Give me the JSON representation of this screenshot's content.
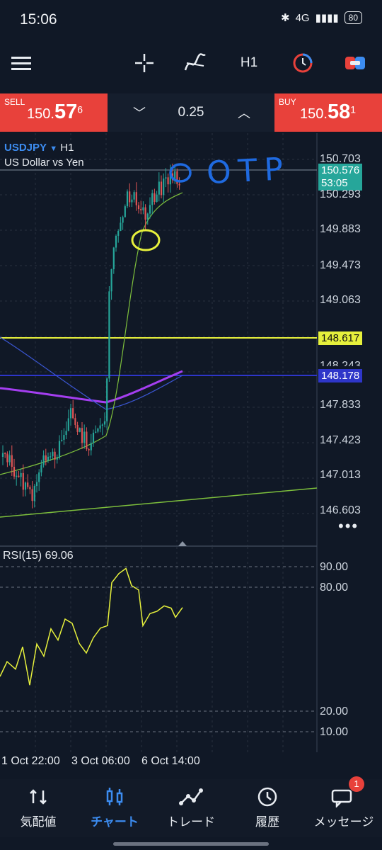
{
  "status": {
    "time": "15:06",
    "network": "4G",
    "battery": "80"
  },
  "toolbar": {
    "timeframe": "H1"
  },
  "trade": {
    "sell_label": "SELL",
    "sell_small": "150.",
    "sell_big": "57",
    "sell_sup": "6",
    "buy_label": "BUY",
    "buy_small": "150.",
    "buy_big": "58",
    "buy_sup": "1",
    "lot": "0.25"
  },
  "chart": {
    "symbol": "USDJPY",
    "timeframe": "H1",
    "description": "US Dollar vs Yen",
    "price_tag": "150.576",
    "countdown": "53:05",
    "yellow_line_tag": "148.617",
    "blue_line_tag": "148.178",
    "y_labels": [
      "150.703",
      "150.293",
      "149.883",
      "149.473",
      "149.063",
      "148.243",
      "147.833",
      "147.423",
      "147.013",
      "146.603"
    ],
    "annotation": "OTP",
    "rsi": {
      "label": "RSI(15) 69.06",
      "levels": [
        "90.00",
        "80.00",
        "20.00",
        "10.00"
      ]
    },
    "x_labels": [
      "1 Oct 22:00",
      "3 Oct 06:00",
      "6 Oct 14:00"
    ]
  },
  "nav": {
    "items": [
      {
        "label": "気配値",
        "icon": "quotes-icon"
      },
      {
        "label": "チャート",
        "icon": "chart-icon"
      },
      {
        "label": "トレード",
        "icon": "trade-icon"
      },
      {
        "label": "履歴",
        "icon": "history-icon"
      },
      {
        "label": "メッセージ",
        "icon": "message-icon"
      }
    ],
    "badge": "1"
  },
  "colors": {
    "sell": "#e8413b",
    "buy": "#e8413b",
    "accent": "#3c8cf0",
    "yellow": "#e6f03c",
    "rsi": "#e6f03c",
    "up_candle": "#26a69a",
    "down_candle": "#e05555"
  }
}
